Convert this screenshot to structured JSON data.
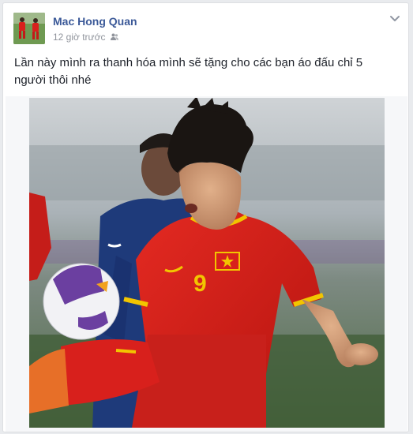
{
  "post": {
    "author_name": "Mac Hong Quan",
    "timestamp": "12 giờ trước",
    "audience_icon": "friends-icon",
    "menu_icon": "chevron-down-icon",
    "text": "Lần này mình ra thanh hóa mình sẽ tặng cho các bạn áo đấu chỉ 5 người thôi nhé",
    "photo": {
      "jersey_number": "9"
    }
  },
  "colors": {
    "author_link": "#3b5998",
    "meta_gray": "#90949c",
    "jersey_red": "#d8201c",
    "jersey_yellow": "#f2c500"
  }
}
